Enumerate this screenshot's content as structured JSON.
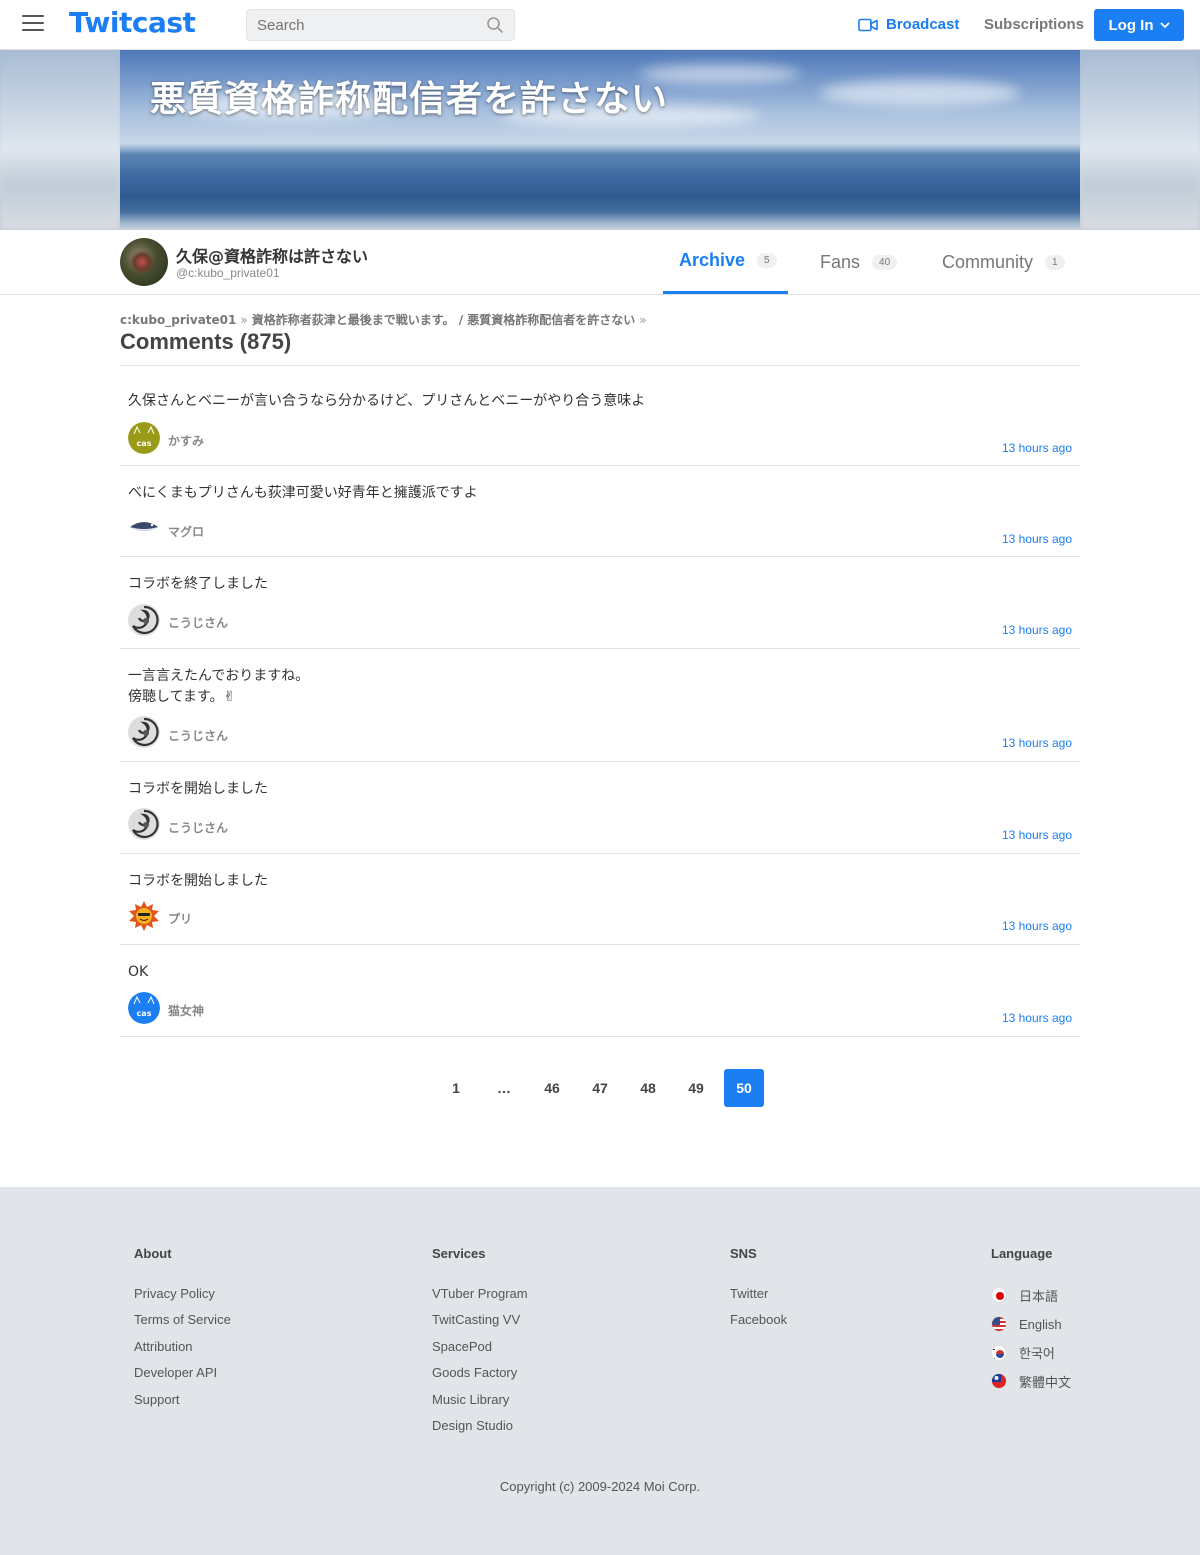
{
  "header": {
    "logo": "Twitcast",
    "search_placeholder": "Search",
    "broadcast_label": "Broadcast",
    "subscriptions_label": "Subscriptions",
    "login_label": "Log In"
  },
  "banner": {
    "title": "悪質資格詐称配信者を許さない"
  },
  "profile": {
    "name": "久保@資格詐称は許さない",
    "id": "@c:kubo_private01"
  },
  "tabs": [
    {
      "label": "Archive",
      "count": "5",
      "active": true
    },
    {
      "label": "Fans",
      "count": "40",
      "active": false
    },
    {
      "label": "Community",
      "count": "1",
      "active": false
    }
  ],
  "breadcrumb": {
    "user": "c:kubo_private01",
    "movie": "資格詐称者荻津と最後まで戦います。 / 悪質資格詐称配信者を許さない",
    "separator": "»"
  },
  "comments_heading": "Comments (875)",
  "comments": [
    {
      "text": "久保さんとベニーが言い合うなら分かるけど、プリさんとベニーがやり合う意味よ",
      "user": "かすみ",
      "time": "13 hours ago",
      "avatar": "cas-cat-olive-icon"
    },
    {
      "text": "べにくまもプリさんも荻津可愛い好青年と擁護派ですよ",
      "user": "マグロ",
      "time": "13 hours ago",
      "avatar": "tuna-fish-icon"
    },
    {
      "text": "コラボを終了しました",
      "user": "こうじさん",
      "time": "13 hours ago",
      "avatar": "swirl-portrait-icon"
    },
    {
      "text": "一言言えたんでおりますね。\n傍聴してます。✌",
      "user": "こうじさん",
      "time": "13 hours ago",
      "avatar": "swirl-portrait-icon"
    },
    {
      "text": "コラボを開始しました",
      "user": "こうじさん",
      "time": "13 hours ago",
      "avatar": "swirl-portrait-icon"
    },
    {
      "text": "コラボを開始しました",
      "user": "プリ",
      "time": "13 hours ago",
      "avatar": "sun-face-icon"
    },
    {
      "text": "OK",
      "user": "猫女神",
      "time": "13 hours ago",
      "avatar": "cas-cat-blue-icon"
    }
  ],
  "pagination": {
    "pages": [
      "1",
      "…",
      "46",
      "47",
      "48",
      "49",
      "50"
    ],
    "active": "50"
  },
  "footer": {
    "about": {
      "heading": "About",
      "links": [
        "Privacy Policy",
        "Terms of Service",
        "Attribution",
        "Developer API",
        "Support"
      ]
    },
    "services": {
      "heading": "Services",
      "links": [
        "VTuber Program",
        "TwitCasting VV",
        "SpacePod",
        "Goods Factory",
        "Music Library",
        "Design Studio"
      ]
    },
    "sns": {
      "heading": "SNS",
      "links": [
        "Twitter",
        "Facebook"
      ]
    },
    "language": {
      "heading": "Language",
      "items": [
        {
          "label": "日本語",
          "flag": "japan-flag-icon"
        },
        {
          "label": "English",
          "flag": "usa-flag-icon"
        },
        {
          "label": "한국어",
          "flag": "korea-flag-icon"
        },
        {
          "label": "繁體中文",
          "flag": "taiwan-flag-icon"
        }
      ]
    },
    "copyright": "Copyright (c) 2009-2024 Moi Corp."
  },
  "colors": {
    "brand": "#1b7ef2",
    "footer_bg": "#e1e4e8"
  }
}
